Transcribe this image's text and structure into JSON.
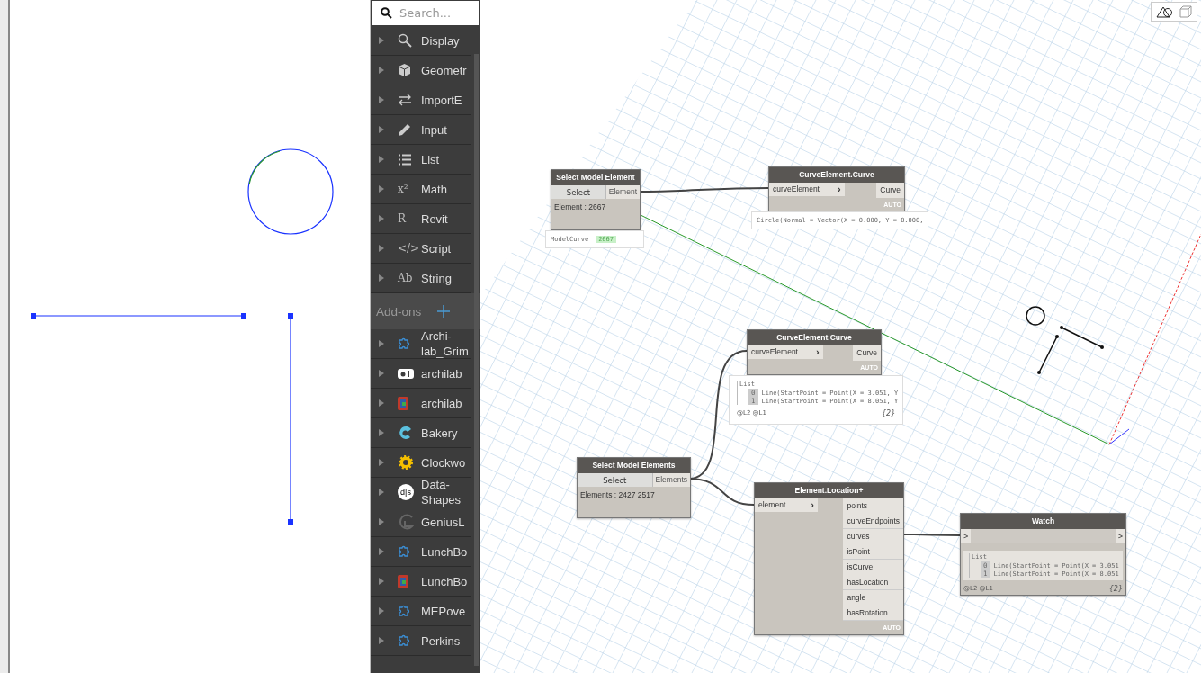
{
  "search": {
    "placeholder": "Search..."
  },
  "view_modes": [
    {
      "selected": true
    },
    {
      "selected": false
    }
  ],
  "library": {
    "categories": [
      {
        "label": "Display"
      },
      {
        "label": "Geometr"
      },
      {
        "label": "ImportE"
      },
      {
        "label": "Input"
      },
      {
        "label": "List"
      },
      {
        "label": "Math",
        "glyph": "x²"
      },
      {
        "label": "Revit",
        "glyph": "R"
      },
      {
        "label": "Script",
        "glyph": "</>"
      },
      {
        "label": "String",
        "glyph": "Ab"
      }
    ],
    "addons_header": "Add-ons",
    "addons": [
      {
        "label": "Archi-lab_Grim"
      },
      {
        "label": "archilab"
      },
      {
        "label": "archilab"
      },
      {
        "label": "Bakery"
      },
      {
        "label": "Clockwo"
      },
      {
        "label": "Data-Shapes",
        "glyph": "d|s"
      },
      {
        "label": "GeniusL"
      },
      {
        "label": "LunchBo"
      },
      {
        "label": "LunchBo"
      },
      {
        "label": "MEPove"
      },
      {
        "label": "Perkins"
      }
    ]
  },
  "nodes": [
    {
      "kind": "select",
      "title": "Select Model Element",
      "button": "Select",
      "output": "Element",
      "value": "Element : 2667",
      "preview": {
        "kind": "tag",
        "type": "ModelCurve",
        "value": "2667"
      }
    },
    {
      "kind": "function",
      "title": "CurveElement.Curve",
      "inputs": [
        "curveElement"
      ],
      "input_marker": "›",
      "outputs": [
        "Curve"
      ],
      "lacing": "AUTO",
      "preview": {
        "kind": "text",
        "text": "Circle(Normal = Vector(X = 0.000, Y = 0.000,"
      }
    },
    {
      "kind": "function",
      "title": "CurveElement.Curve",
      "inputs": [
        "curveElement"
      ],
      "input_marker": "›",
      "outputs": [
        "Curve"
      ],
      "lacing": "AUTO",
      "preview": {
        "kind": "list",
        "label": "List",
        "items": [
          {
            "index": "0",
            "text": "Line(StartPoint = Point(X = 3.051, Y"
          },
          {
            "index": "1",
            "text": "Line(StartPoint = Point(X = 8.051, Y"
          }
        ],
        "levels": "@L2 @L1",
        "count": "{2}"
      }
    },
    {
      "kind": "select",
      "title": "Select Model Elements",
      "button": "Select",
      "output": "Elements",
      "value": "Elements : 2427 2517"
    },
    {
      "kind": "function",
      "title": "Element.Location+",
      "inputs": [
        "element"
      ],
      "input_marker": "›",
      "outputs": [
        "points",
        "curveEndpoints",
        "curves",
        "isPoint",
        "isCurve",
        "hasLocation",
        "angle",
        "hasRotation"
      ],
      "lacing": "AUTO"
    },
    {
      "kind": "watch",
      "title": "Watch",
      "input": ">",
      "output": ">",
      "preview": {
        "kind": "list",
        "label": "List",
        "items": [
          {
            "index": "0",
            "text": "Line(StartPoint = Point(X = 3.051"
          },
          {
            "index": "1",
            "text": "Line(StartPoint = Point(X = 8.051"
          }
        ],
        "levels": "@L2 @L1",
        "count": "{2}"
      }
    }
  ]
}
